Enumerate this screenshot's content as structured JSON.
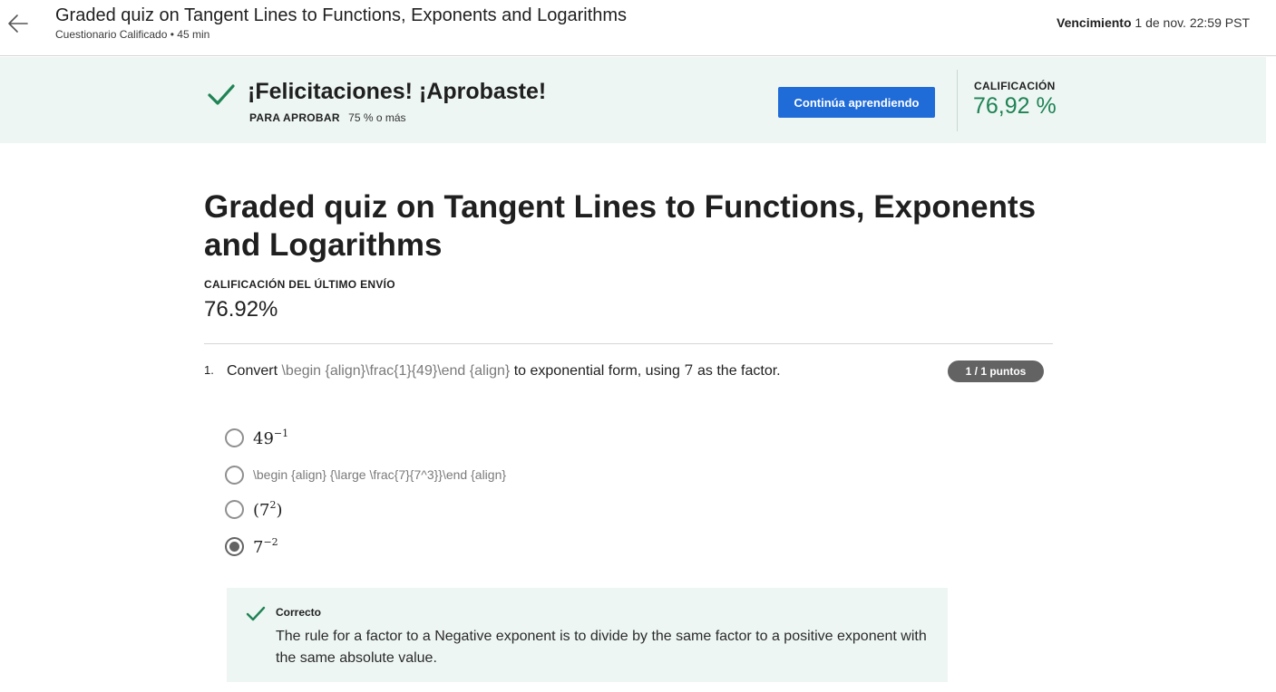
{
  "header": {
    "title": "Graded quiz on Tangent Lines to Functions, Exponents and Logarithms",
    "subtitle": "Cuestionario Calificado • 45 min",
    "due_label": "Vencimiento",
    "due_value": "1 de nov. 22:59 PST",
    "back_icon": "arrow-left-icon"
  },
  "banner": {
    "title": "¡Felicitaciones! ¡Aprobaste!",
    "pass_label": "PARA APROBAR",
    "pass_value": "75 % o más",
    "continue_button": "Continúa aprendiendo",
    "grade_label": "CALIFICACIÓN",
    "grade_value": "76,92 %",
    "check_icon": "check-icon",
    "accent_color": "#1f8354",
    "button_color": "#1f6bd8",
    "background_color": "#edf6f3"
  },
  "main": {
    "title": "Graded quiz on Tangent Lines to Functions, Exponents and Logarithms",
    "last_submission_label": "CALIFICACIÓN DEL ÚLTIMO ENVÍO",
    "last_submission_value": "76.92%"
  },
  "question": {
    "number": "1.",
    "text_before": "Convert ",
    "latex_raw": "\\begin {align}\\frac{1}{49}\\end {align}",
    "text_middle": " to exponential form, using ",
    "factor": "7",
    "text_after": " as the factor.",
    "points": "1 / 1 puntos",
    "options": [
      {
        "base": "49",
        "exponent": "−1",
        "selected": false
      },
      {
        "raw": "\\begin {align} {\\large \\frac{7}{7^3}}\\end {align}",
        "selected": false
      },
      {
        "open": "(",
        "base": "7",
        "exponent": "2",
        "close": ")",
        "selected": false
      },
      {
        "base": "7",
        "exponent": "−2",
        "selected": true
      }
    ],
    "feedback": {
      "label": "Correcto",
      "text": "The rule for a factor to a Negative exponent is to divide by the same factor to a positive exponent with the same absolute value.",
      "icon": "check-icon"
    }
  }
}
